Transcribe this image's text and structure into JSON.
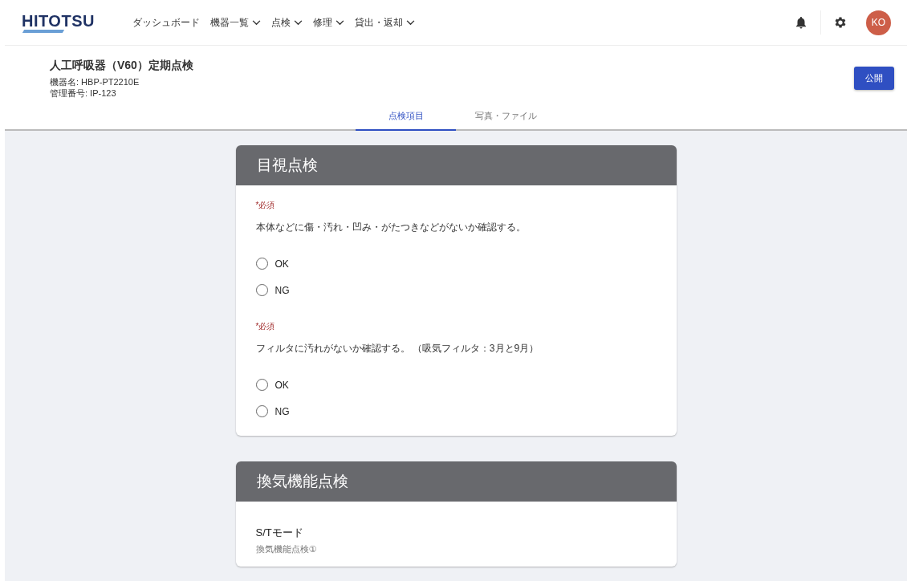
{
  "header": {
    "logo": "HITOTSU",
    "nav": [
      {
        "label": "ダッシュボード",
        "dropdown": false
      },
      {
        "label": "機器一覧",
        "dropdown": true
      },
      {
        "label": "点検",
        "dropdown": true
      },
      {
        "label": "修理",
        "dropdown": true
      },
      {
        "label": "貸出・返却",
        "dropdown": true
      }
    ],
    "avatar": "KO"
  },
  "page": {
    "title": "人工呼吸器（V60）定期点検",
    "meta": [
      "機器名: HBP-PT2210E",
      "管理番号: IP-123"
    ],
    "publish_button": "公開"
  },
  "tabs": [
    {
      "label": "点検項目",
      "selected": true
    },
    {
      "label": "写真・ファイル",
      "selected": false
    }
  ],
  "sections": [
    {
      "title": "目視点検",
      "items": [
        {
          "kind": "radio",
          "required": "*必須",
          "question": "本体などに傷・汚れ・凹み・がたつきなどがないか確認する。",
          "options": [
            {
              "label": "OK",
              "selected": false
            },
            {
              "label": "NG",
              "selected": false
            }
          ]
        },
        {
          "kind": "radio",
          "required": "*必須",
          "question": "フィルタに汚れがないか確認する。 （吸気フィルタ：3月と9月）",
          "options": [
            {
              "label": "OK",
              "selected": false
            },
            {
              "label": "NG",
              "selected": false
            }
          ]
        }
      ]
    },
    {
      "title": "換気機能点検",
      "items": [
        {
          "kind": "heading",
          "label": "S/Tモード",
          "sub": "換気機能点検①"
        }
      ]
    }
  ]
}
